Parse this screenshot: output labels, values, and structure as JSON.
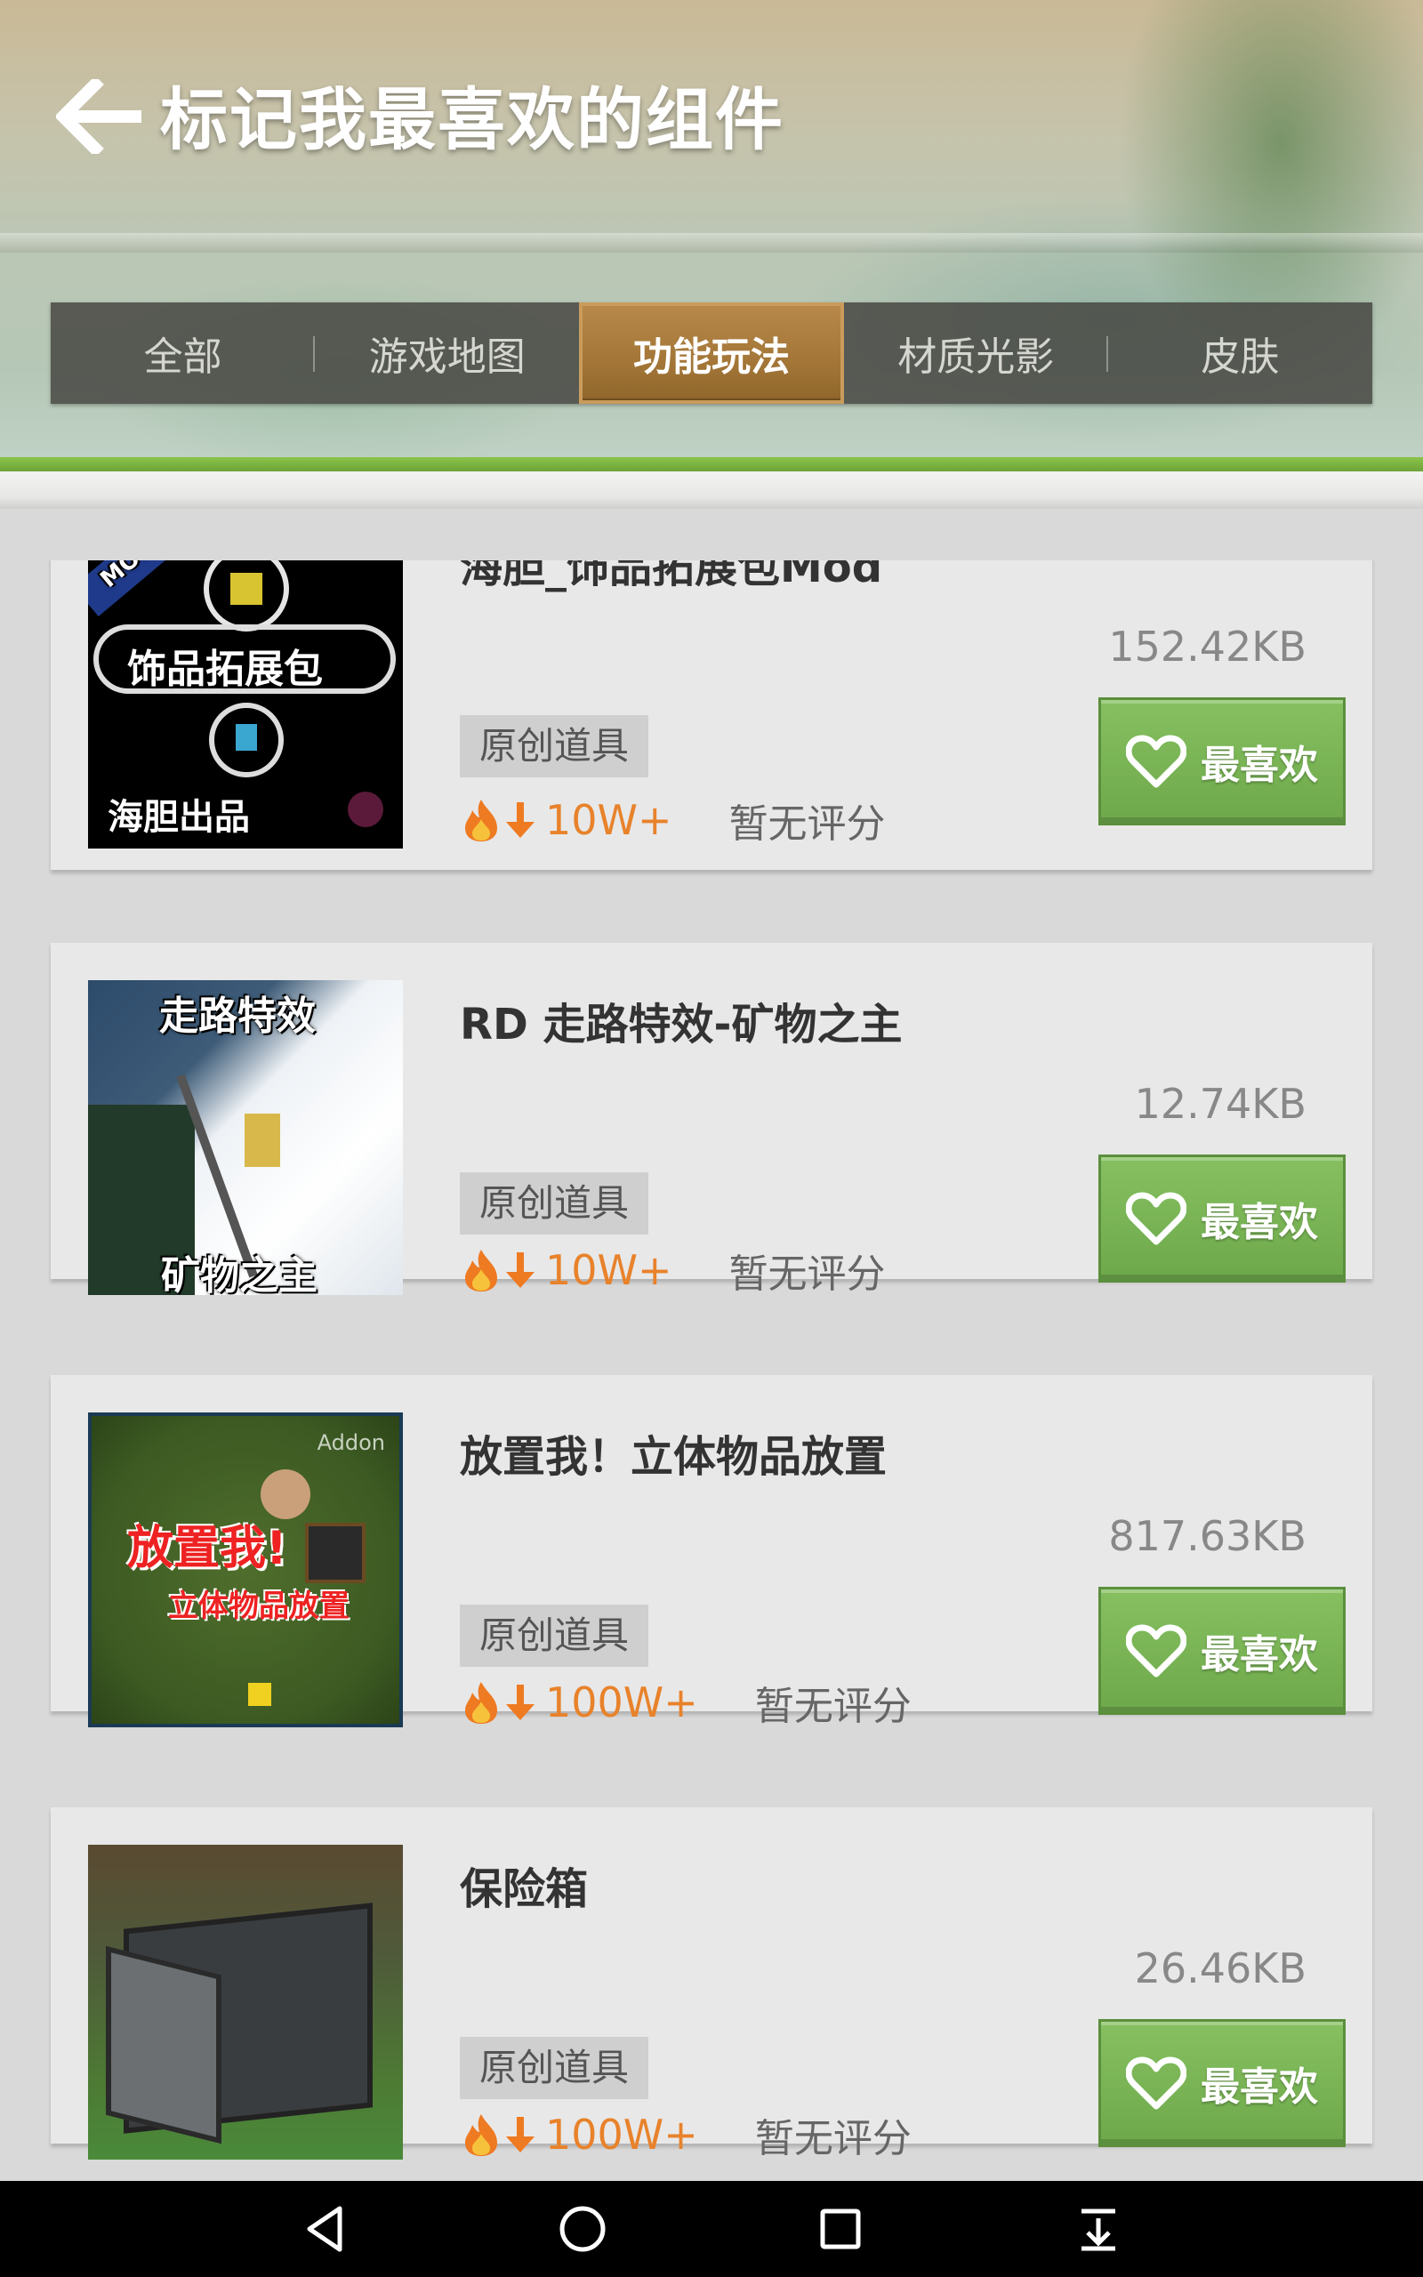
{
  "header": {
    "title": "标记我最喜欢的组件",
    "back_icon": "arrow-left-icon"
  },
  "tabs": [
    {
      "label": "全部",
      "active": false
    },
    {
      "label": "游戏地图",
      "active": false
    },
    {
      "label": "功能玩法",
      "active": true
    },
    {
      "label": "材质光影",
      "active": false
    },
    {
      "label": "皮肤",
      "active": false
    }
  ],
  "items": [
    {
      "title": "海胆_饰品拓展包Mod",
      "size": "152.42KB",
      "tag": "原创道具",
      "downloads": "10W+",
      "rating": "暂无评分",
      "favorite_label": "最喜欢",
      "thumb_texts": [
        "MOD",
        "饰品拓展包",
        "海胆出品"
      ]
    },
    {
      "title": "RD 走路特效-矿物之主",
      "size": "12.74KB",
      "tag": "原创道具",
      "downloads": "10W+",
      "rating": "暂无评分",
      "favorite_label": "最喜欢",
      "thumb_texts": [
        "走路特效",
        "矿物之主"
      ]
    },
    {
      "title": "放置我！立体物品放置",
      "size": "817.63KB",
      "tag": "原创道具",
      "downloads": "100W+",
      "rating": "暂无评分",
      "favorite_label": "最喜欢",
      "thumb_texts": [
        "Addon",
        "放置我!",
        "立体物品放置"
      ]
    },
    {
      "title": "保险箱",
      "size": "26.46KB",
      "tag": "原创道具",
      "downloads": "100W+",
      "rating": "暂无评分",
      "favorite_label": "最喜欢",
      "thumb_texts": []
    }
  ],
  "colors": {
    "accent_green": "#6da84a",
    "active_tab": "#a37637",
    "downloads_orange": "#e8822b"
  },
  "navbar": {
    "icons": [
      "back-triangle-icon",
      "home-circle-icon",
      "recents-square-icon",
      "notification-pulldown-icon"
    ]
  }
}
